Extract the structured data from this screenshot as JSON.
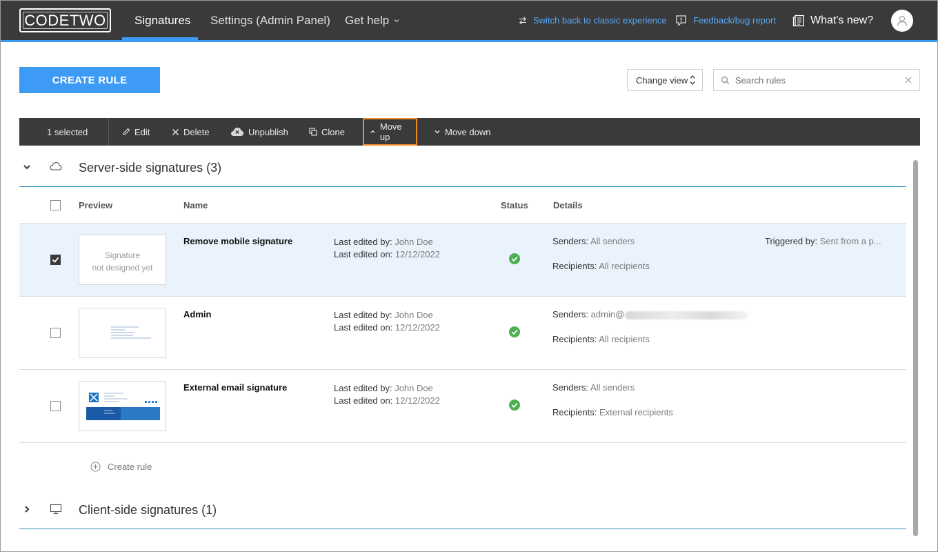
{
  "header": {
    "logo_text": "CODETWO",
    "tabs": [
      {
        "label": "Signatures",
        "active": true
      },
      {
        "label": "Settings (Admin Panel)",
        "active": false
      },
      {
        "label": "Get help",
        "active": false
      }
    ],
    "switch_link": "Switch back to classic experience",
    "feedback_link": "Feedback/bug report",
    "whats_new": "What's new?",
    "accent_color": "#3d9af5"
  },
  "toolbar": {
    "create_rule_label": "CREATE RULE",
    "change_view_label": "Change view",
    "search_placeholder": "Search rules"
  },
  "actionbar": {
    "selected_text": "1 selected",
    "edit": "Edit",
    "delete": "Delete",
    "unpublish": "Unpublish",
    "clone": "Clone",
    "move_up": "Move up",
    "move_down": "Move down"
  },
  "groups": {
    "server": {
      "title": "Server-side signatures (3)"
    },
    "client": {
      "title": "Client-side signatures (1)"
    }
  },
  "table": {
    "headers": {
      "preview": "Preview",
      "name": "Name",
      "status": "Status",
      "details": "Details"
    },
    "rows": [
      {
        "name": "Remove mobile signature",
        "preview_text_1": "Signature",
        "preview_text_2": "not designed yet",
        "edited_by_label": "Last edited by:",
        "edited_by": "John Doe",
        "edited_on_label": "Last edited on:",
        "edited_on": "12/12/2022",
        "senders_label": "Senders:",
        "senders": "All senders",
        "recipients_label": "Recipients:",
        "recipients": "All recipients",
        "triggered_label": "Triggered by:",
        "triggered": "Sent from a p...",
        "checked": true
      },
      {
        "name": "Admin",
        "edited_by_label": "Last edited by:",
        "edited_by": "John Doe",
        "edited_on_label": "Last edited on:",
        "edited_on": "12/12/2022",
        "senders_label": "Senders:",
        "senders": "admin@",
        "recipients_label": "Recipients:",
        "recipients": "All recipients",
        "checked": false
      },
      {
        "name": "External email signature",
        "edited_by_label": "Last edited by:",
        "edited_by": "John Doe",
        "edited_on_label": "Last edited on:",
        "edited_on": "12/12/2022",
        "senders_label": "Senders:",
        "senders": "All senders",
        "recipients_label": "Recipients:",
        "recipients": "External recipients",
        "checked": false
      }
    ]
  },
  "create_rule_link": "Create rule",
  "status_color": "#4caf50"
}
